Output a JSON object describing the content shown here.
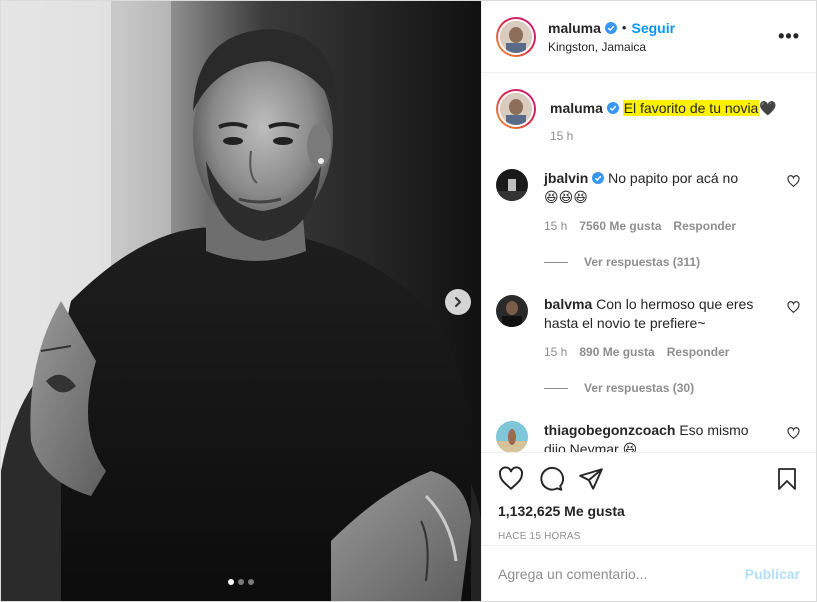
{
  "post": {
    "author": "maluma",
    "follow_label": "Seguir",
    "separator": "•",
    "location": "Kingston, Jamaica",
    "more_label": "•••"
  },
  "caption": {
    "author": "maluma",
    "text_highlighted": "El favorito de tu novia",
    "emoji": "🖤",
    "time": "15 h"
  },
  "comments": [
    {
      "author": "jbalvin",
      "verified": true,
      "text": "No papito por acá no",
      "emoji_line": "😆😆😆",
      "time": "15 h",
      "likes": "7560 Me gusta",
      "reply_label": "Responder",
      "view_replies": "Ver respuestas (311)"
    },
    {
      "author": "balvma",
      "verified": false,
      "text": "Con lo hermoso que eres hasta el novio te prefiere~",
      "time": "15 h",
      "likes": "890 Me gusta",
      "reply_label": "Responder",
      "view_replies": "Ver respuestas (30)"
    },
    {
      "author": "thiagobegonzcoach",
      "verified": false,
      "text": "Eso mismo dijo Neymar",
      "emoji": "😆"
    }
  ],
  "actions": {
    "likes": "1,132,625 Me gusta",
    "time_ago": "HACE 15 HORAS"
  },
  "comment_box": {
    "placeholder": "Agrega un comentario...",
    "publish_label": "Publicar"
  },
  "carousel": {
    "count": 3,
    "active": 1
  },
  "colors": {
    "link": "#0095f6",
    "highlight": "#fff200",
    "muted": "#8e8e8e",
    "publish_disabled": "#b2dffc"
  }
}
